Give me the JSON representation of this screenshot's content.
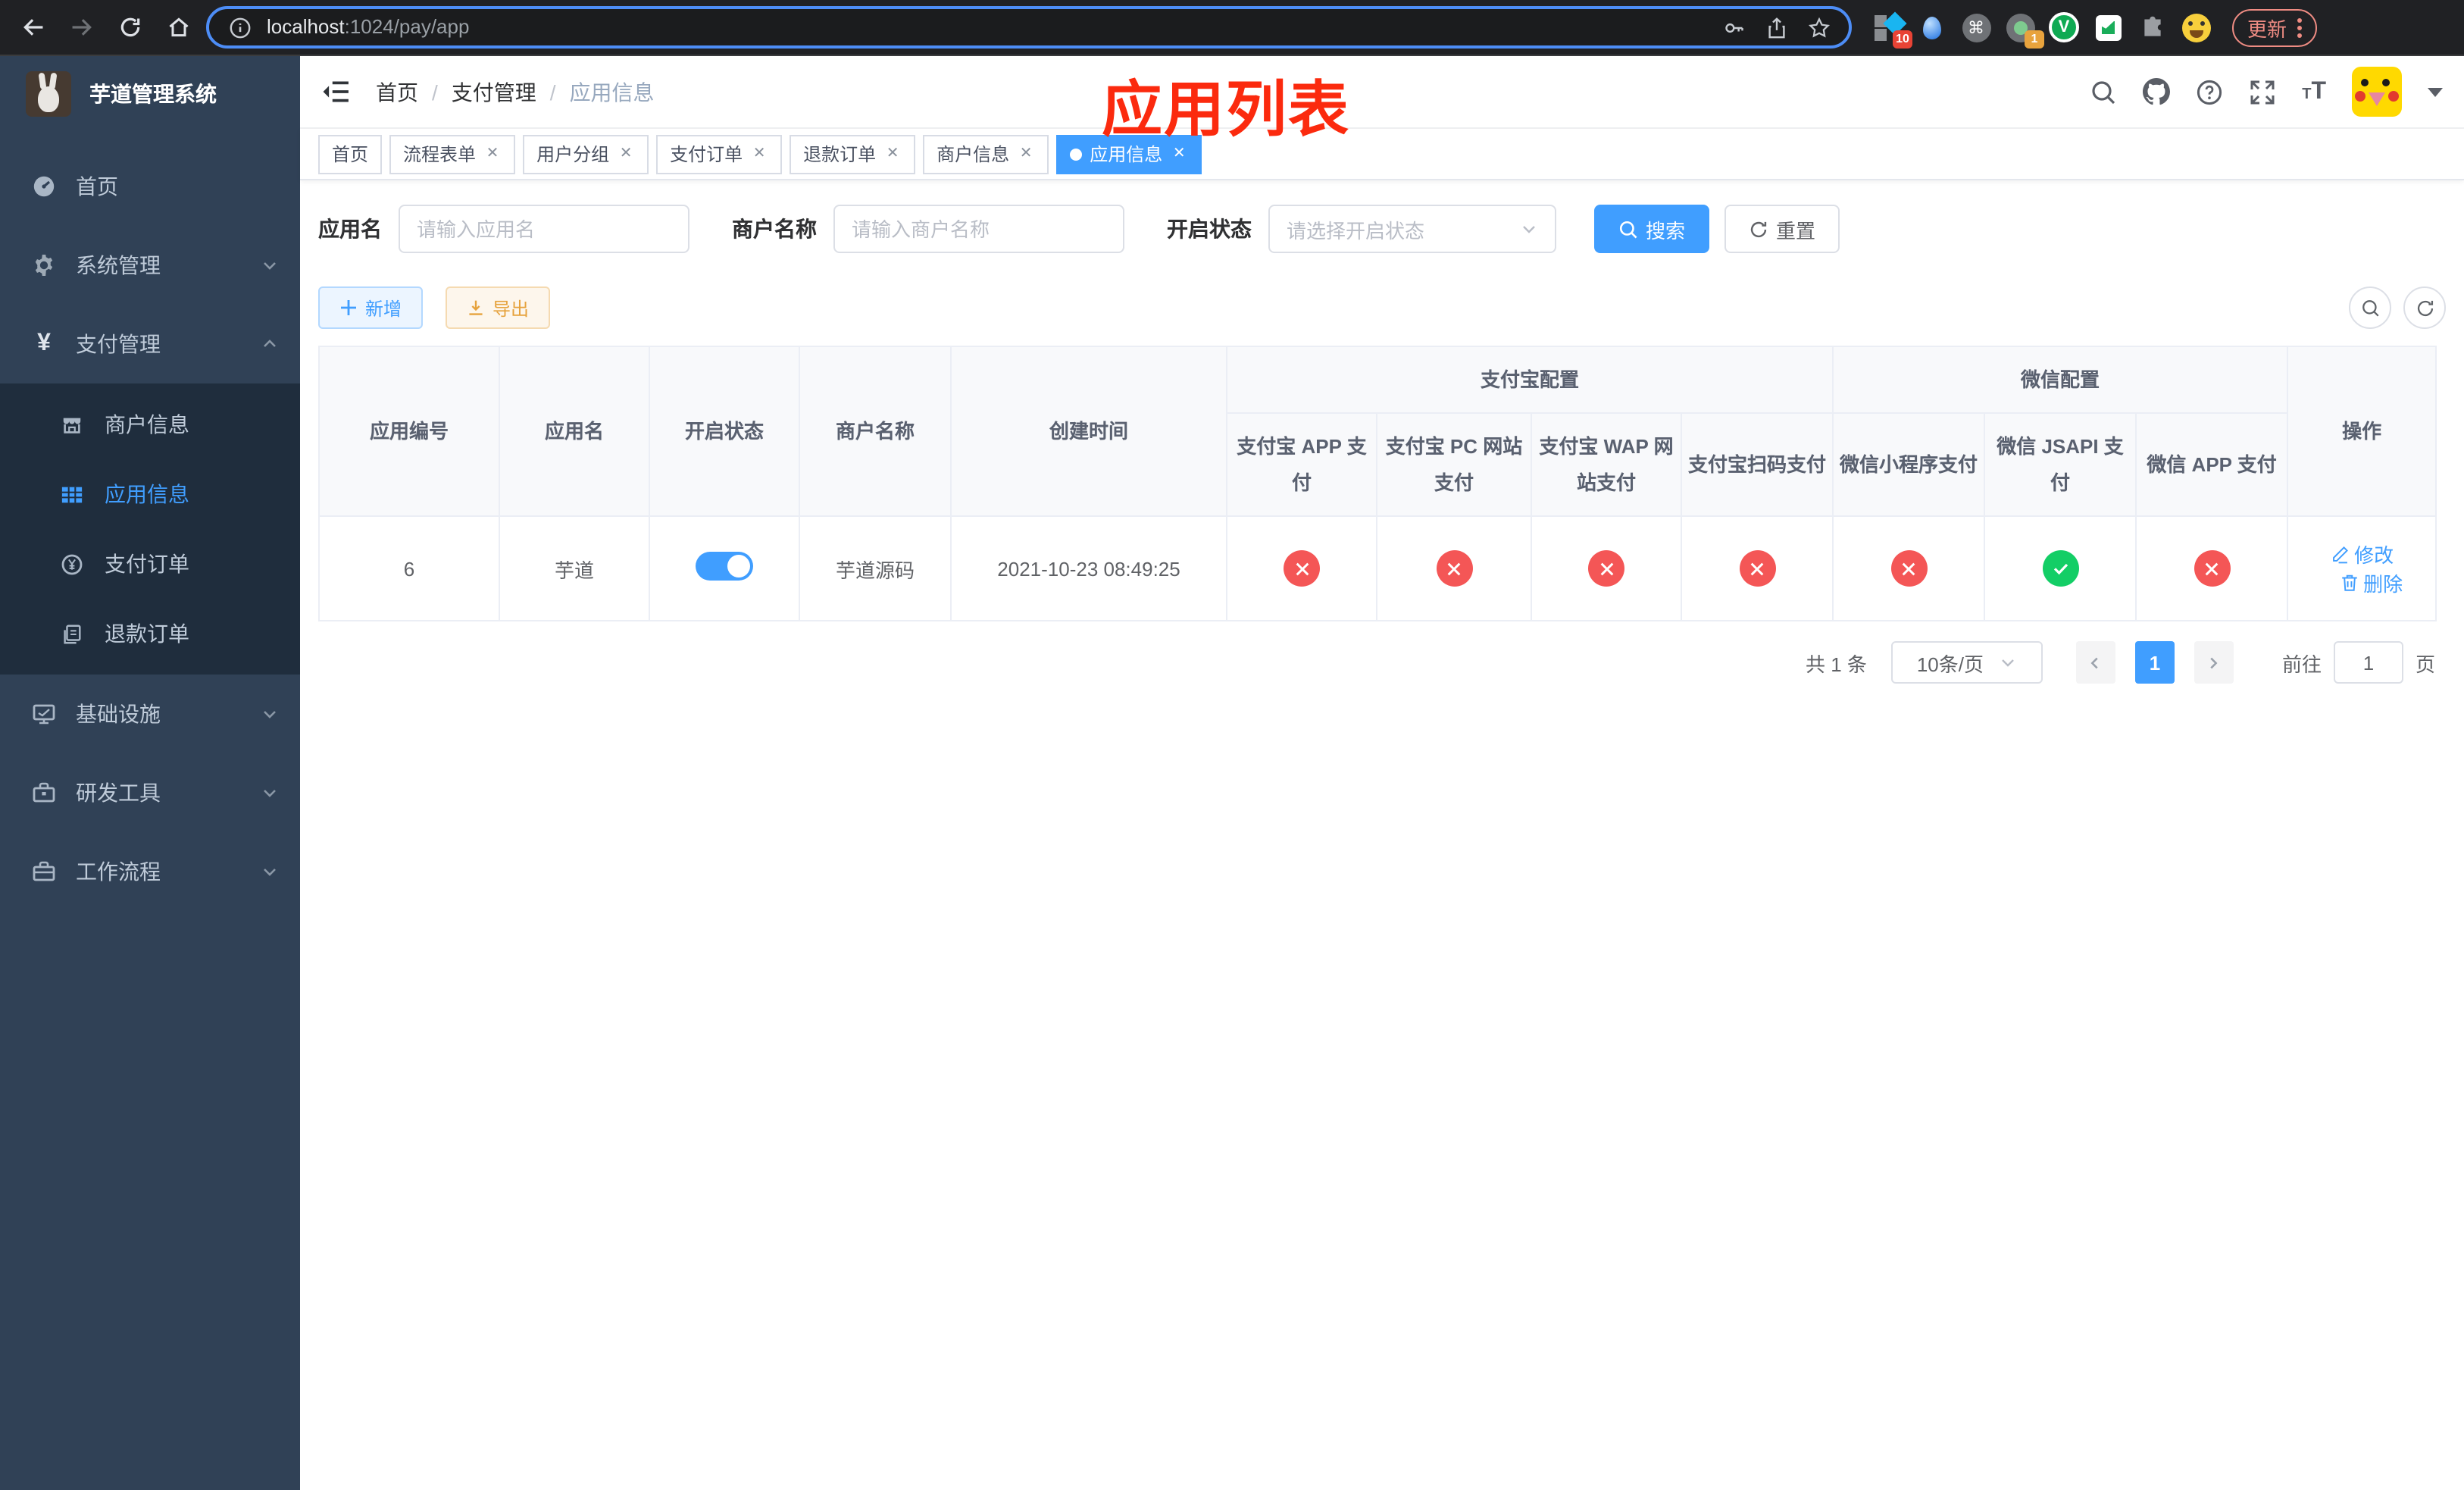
{
  "browser": {
    "url_host": "localhost",
    "url_rest": ":1024/pay/app",
    "update_button": "更新",
    "ext_badges": {
      "pinned_grid": "10",
      "recorder": "1"
    }
  },
  "sidebar": {
    "title": "芋道管理系统",
    "items": [
      {
        "label": "首页"
      },
      {
        "label": "系统管理"
      },
      {
        "label": "支付管理"
      },
      {
        "label": "基础设施"
      },
      {
        "label": "研发工具"
      },
      {
        "label": "工作流程"
      }
    ],
    "submenu": [
      {
        "label": "商户信息"
      },
      {
        "label": "应用信息"
      },
      {
        "label": "支付订单"
      },
      {
        "label": "退款订单"
      }
    ]
  },
  "header": {
    "breadcrumb": [
      "首页",
      "支付管理",
      "应用信息"
    ],
    "annotation": "应用列表"
  },
  "tags": [
    {
      "label": "首页"
    },
    {
      "label": "流程表单"
    },
    {
      "label": "用户分组"
    },
    {
      "label": "支付订单"
    },
    {
      "label": "退款订单"
    },
    {
      "label": "商户信息"
    },
    {
      "label": "应用信息"
    }
  ],
  "filters": {
    "app_name_label": "应用名",
    "app_name_placeholder": "请输入应用名",
    "merchant_label": "商户名称",
    "merchant_placeholder": "请输入商户名称",
    "status_label": "开启状态",
    "status_placeholder": "请选择开启状态",
    "search_button": "搜索",
    "reset_button": "重置"
  },
  "toolbar": {
    "add_button": "新增",
    "export_button": "导出"
  },
  "table": {
    "columns": [
      "应用编号",
      "应用名",
      "开启状态",
      "商户名称",
      "创建时间"
    ],
    "groups": [
      {
        "label": "支付宝配置",
        "children": [
          "支付宝 APP 支付",
          "支付宝 PC 网站支付",
          "支付宝 WAP 网站支付",
          "支付宝扫码支付"
        ]
      },
      {
        "label": "微信配置",
        "children": [
          "微信小程序支付",
          "微信 JSAPI 支付",
          "微信 APP 支付"
        ]
      }
    ],
    "actions_column": "操作",
    "row": {
      "id": "6",
      "name": "芋道",
      "enabled": true,
      "merchant": "芋道源码",
      "created": "2021-10-23 08:49:25",
      "pay_channels": [
        "no",
        "no",
        "no",
        "no",
        "no",
        "yes",
        "no"
      ],
      "edit": "修改",
      "delete": "删除"
    }
  },
  "pagination": {
    "total": "共 1 条",
    "page_size": "10条/页",
    "page": "1",
    "goto_label": "前往",
    "goto_value": "1",
    "goto_suffix": "页"
  },
  "colors": {
    "accent": "#409EFF",
    "success": "#13ce66",
    "danger": "#f45656",
    "warning": "#e6a23c",
    "sidebar_bg": "#304156",
    "submenu_bg": "#1f2d3d",
    "annotation": "#fb2a0e"
  }
}
